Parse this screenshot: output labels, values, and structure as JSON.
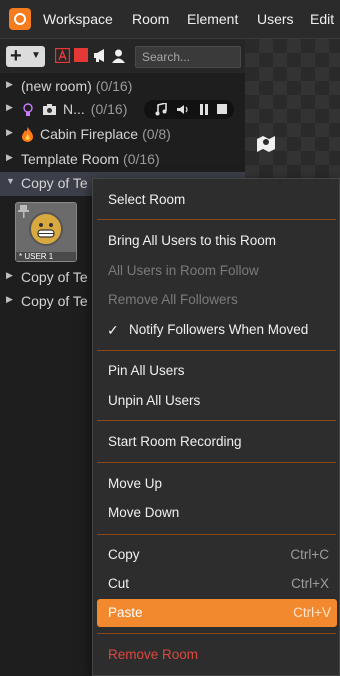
{
  "menubar": {
    "items": [
      "Workspace",
      "Room",
      "Element",
      "Users",
      "Edit"
    ]
  },
  "toolbar": {
    "add_label": "+",
    "search_placeholder": "Search..."
  },
  "rooms": [
    {
      "name": "(new room)",
      "count": "(0/16)"
    },
    {
      "name": "N...",
      "count": "(0/16)"
    },
    {
      "name": "Cabin Fireplace",
      "count": "(0/8)"
    },
    {
      "name": "Template Room",
      "count": "(0/16)"
    },
    {
      "name": "Copy of Te",
      "count": ""
    },
    {
      "name": "Copy of Te",
      "count": ""
    },
    {
      "name": "Copy of Te",
      "count": ""
    }
  ],
  "avatar": {
    "label": "* USER 1"
  },
  "context_menu": {
    "items": [
      {
        "label": "Select Room"
      },
      {
        "label": "Bring All Users to this Room"
      },
      {
        "label": "All Users in Room Follow"
      },
      {
        "label": "Remove All Followers"
      },
      {
        "label": "Notify Followers When Moved"
      },
      {
        "label": "Pin All Users"
      },
      {
        "label": "Unpin All Users"
      },
      {
        "label": "Start Room Recording"
      },
      {
        "label": "Move Up"
      },
      {
        "label": "Move Down"
      },
      {
        "label": "Copy",
        "shortcut": "Ctrl+C"
      },
      {
        "label": "Cut",
        "shortcut": "Ctrl+X"
      },
      {
        "label": "Paste",
        "shortcut": "Ctrl+V"
      },
      {
        "label": "Remove Room"
      }
    ]
  },
  "colors": {
    "accent": "#f3892e",
    "danger": "#d84a3f",
    "background": "#1e1e1e"
  }
}
